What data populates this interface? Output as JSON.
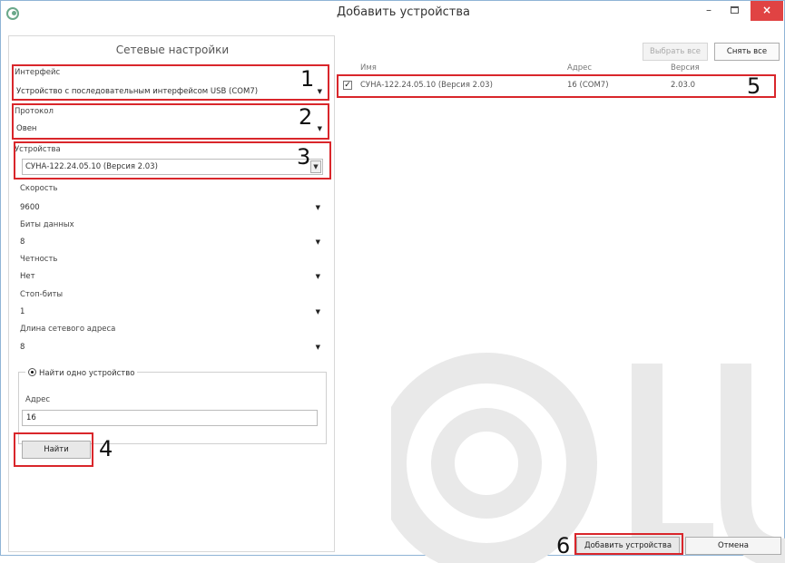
{
  "window": {
    "title": "Добавить устройства",
    "minimize": "–",
    "close": "×"
  },
  "left": {
    "title": "Сетевые настройки",
    "interface": {
      "label": "Интерфейс",
      "value": "Устройство с последовательным интерфейсом USB (COM7)"
    },
    "protocol": {
      "label": "Протокол",
      "value": "Овен"
    },
    "devices": {
      "label": "Устройства",
      "value": "СУНА-122.24.05.10 (Версия 2.03)"
    },
    "speed": {
      "label": "Скорость",
      "value": "9600"
    },
    "data_bits": {
      "label": "Биты данных",
      "value": "8"
    },
    "parity": {
      "label": "Четность",
      "value": "Нет"
    },
    "stop_bits": {
      "label": "Стоп-биты",
      "value": "1"
    },
    "address_length": {
      "label": "Длина сетевого адреса",
      "value": "8"
    },
    "find_one": {
      "label": "Найти одно устройство"
    },
    "address": {
      "label": "Адрес",
      "value": "16"
    },
    "find_button": "Найти"
  },
  "right": {
    "select_all": "Выбрать все",
    "deselect_all": "Снять все",
    "columns": [
      "Имя",
      "Адрес",
      "Версия"
    ],
    "rows": [
      {
        "checked": "✓",
        "name": "СУНА-122.24.05.10 (Версия 2.03)",
        "address": "16 (COM7)",
        "version": "2.03.0"
      }
    ],
    "add_button": "Добавить устройства",
    "cancel_button": "Отмена"
  },
  "callouts": [
    "1",
    "2",
    "3",
    "4",
    "5",
    "6"
  ],
  "colors": {
    "highlight": "#d9262b",
    "close": "#e04343"
  },
  "icons": {
    "app": "app-logo-icon",
    "dropdown": "chevron-down-icon",
    "watermark": "watermark-logo"
  }
}
